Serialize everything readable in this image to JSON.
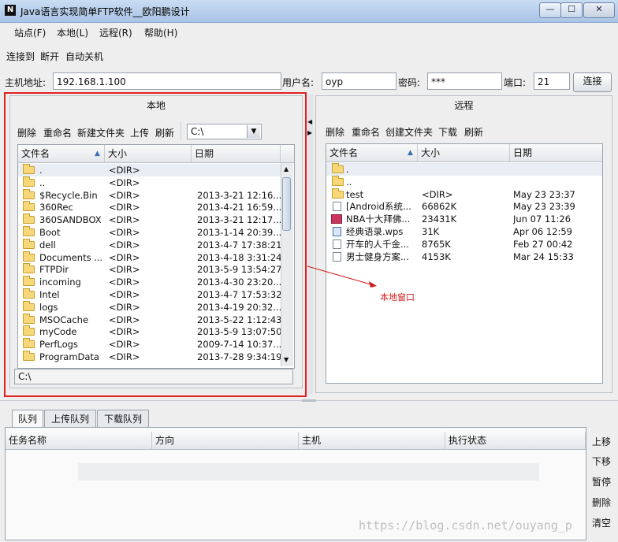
{
  "window": {
    "title": "Java语言实现简单FTP软件__欧阳鹏设计",
    "icon_glyph": "N",
    "min_glyph": "—",
    "max_glyph": "☐",
    "close_glyph": "✕"
  },
  "menu": {
    "site": "站点(F)",
    "local": "本地(L)",
    "remote": "远程(R)",
    "help": "帮助(H)"
  },
  "toolbar": {
    "connect": "连接到",
    "disconnect": "断开",
    "auto_shutdown": "自动关机"
  },
  "connection": {
    "host_label": "主机地址:",
    "host_value": "192.168.1.100",
    "user_label": "用户名:",
    "user_value": "oyp",
    "password_label": "密码:",
    "password_value": "***",
    "port_label": "端口:",
    "port_value": "21",
    "connect_button": "连接"
  },
  "local_panel": {
    "title": "本地",
    "actions": {
      "delete": "删除",
      "rename": "重命名",
      "new_folder": "新建文件夹",
      "upload": "上传",
      "refresh": "刷新"
    },
    "drive_select": "C:\\",
    "columns": {
      "name": "文件名",
      "size": "大小",
      "date": "日期",
      "sort_arrow": "▲"
    },
    "path_text": "C:\\",
    "rows": [
      {
        "name": ".",
        "size": "<DIR>",
        "date": ""
      },
      {
        "name": "..",
        "size": "<DIR>",
        "date": ""
      },
      {
        "name": "$Recycle.Bin",
        "size": "<DIR>",
        "date": "2013-3-21 12:16..."
      },
      {
        "name": "360Rec",
        "size": "<DIR>",
        "date": "2013-4-21 16:59..."
      },
      {
        "name": "360SANDBOX",
        "size": "<DIR>",
        "date": "2013-3-21 12:17..."
      },
      {
        "name": "Boot",
        "size": "<DIR>",
        "date": "2013-1-14 20:39..."
      },
      {
        "name": "dell",
        "size": "<DIR>",
        "date": "2013-4-7 17:38:21"
      },
      {
        "name": "Documents ...",
        "size": "<DIR>",
        "date": "2013-4-18 3:31:24"
      },
      {
        "name": "FTPDir",
        "size": "<DIR>",
        "date": "2013-5-9 13:54:27"
      },
      {
        "name": "incoming",
        "size": "<DIR>",
        "date": "2013-4-30 23:20..."
      },
      {
        "name": "Intel",
        "size": "<DIR>",
        "date": "2013-4-7 17:53:32"
      },
      {
        "name": "logs",
        "size": "<DIR>",
        "date": "2013-4-19 20:32..."
      },
      {
        "name": "MSOCache",
        "size": "<DIR>",
        "date": "2013-5-22 1:12:43"
      },
      {
        "name": "myCode",
        "size": "<DIR>",
        "date": "2013-5-9 13:07:50"
      },
      {
        "name": "PerfLogs",
        "size": "<DIR>",
        "date": "2009-7-14 10:37..."
      },
      {
        "name": "ProgramData",
        "size": "<DIR>",
        "date": "2013-7-28 9:34:19"
      }
    ]
  },
  "remote_panel": {
    "title": "远程",
    "actions": {
      "delete": "删除",
      "rename": "重命名",
      "new_folder": "创建文件夹",
      "download": "下载",
      "refresh": "刷新"
    },
    "columns": {
      "name": "文件名",
      "size": "大小",
      "date": "日期",
      "sort_arrow": "▲"
    },
    "rows": [
      {
        "name": ".",
        "size": "",
        "date": "",
        "icon": "folder"
      },
      {
        "name": "..",
        "size": "",
        "date": "",
        "icon": "folder"
      },
      {
        "name": "test",
        "size": "<DIR>",
        "date": "May 23 23:37",
        "icon": "folder"
      },
      {
        "name": "[Android系统...",
        "size": "66862K",
        "date": "May 23 23:39",
        "icon": "file"
      },
      {
        "name": "NBA十大拜佛...",
        "size": "23431K",
        "date": "Jun 07 11:26",
        "icon": "flv"
      },
      {
        "name": "经典语录.wps",
        "size": "31K",
        "date": "Apr 06 12:59",
        "icon": "wps"
      },
      {
        "name": "开车的人千金...",
        "size": "8765K",
        "date": "Feb 27 00:42",
        "icon": "file"
      },
      {
        "name": "男士健身方案...",
        "size": "4153K",
        "date": "Mar 24 15:33",
        "icon": "file"
      }
    ]
  },
  "annotation": {
    "label": "本地窗口",
    "color": "#d11a1a"
  },
  "queue": {
    "tabs": [
      "队列",
      "上传队列",
      "下载队列"
    ],
    "columns": [
      "任务名称",
      "方向",
      "主机",
      "执行状态"
    ],
    "buttons": [
      "上移",
      "下移",
      "暂停",
      "删除",
      "清空"
    ]
  },
  "watermark": "https://blog.csdn.net/ouyang_p"
}
